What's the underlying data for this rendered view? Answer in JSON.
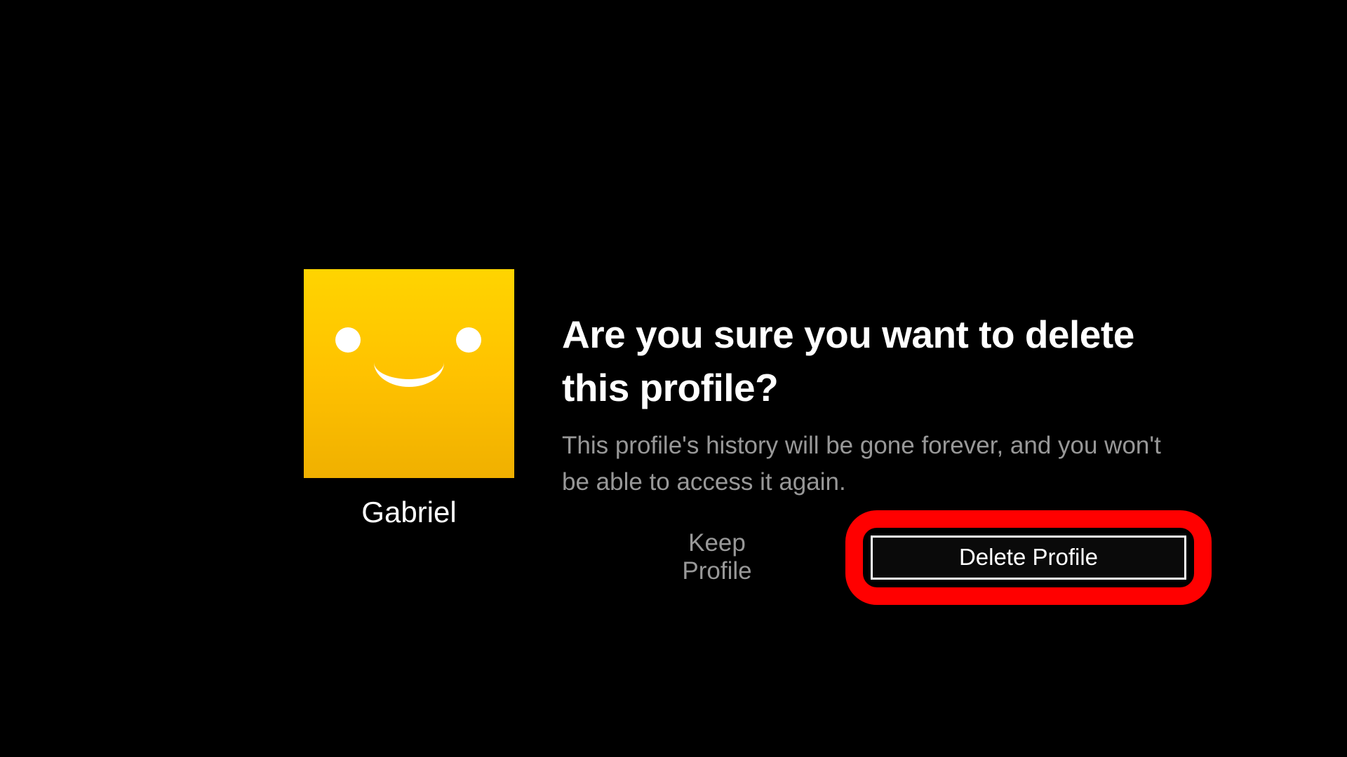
{
  "profile": {
    "name": "Gabriel"
  },
  "dialog": {
    "title": "Are you sure you want to delete this profile?",
    "description": "This profile's history will be gone forever, and you won't be able to access it again."
  },
  "buttons": {
    "keep": "Keep Profile",
    "delete": "Delete Profile"
  }
}
